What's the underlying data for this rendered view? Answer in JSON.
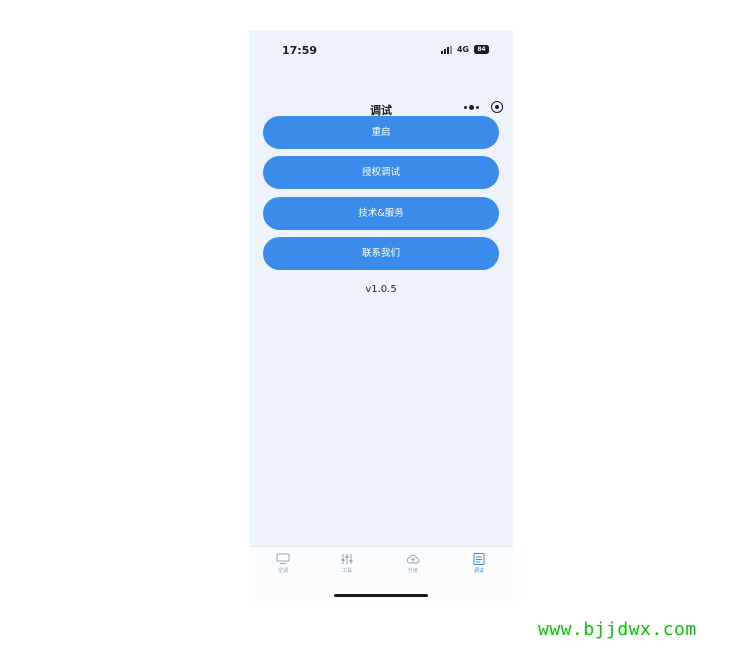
{
  "status_bar": {
    "time": "17:59",
    "network": "4G",
    "battery": "84",
    "signal_icon": "signal-bars-icon"
  },
  "nav": {
    "title": "调试",
    "more_icon": "more-dots-icon",
    "close_icon": "close-circle-icon"
  },
  "buttons": [
    {
      "label": "重启"
    },
    {
      "label": "授权调试"
    },
    {
      "label": "技术&服务"
    },
    {
      "label": "联系我们"
    }
  ],
  "version": "v1.0.5",
  "tabs": [
    {
      "label": "空调",
      "icon": "monitor-icon",
      "active": false
    },
    {
      "label": "工具",
      "icon": "sliders-icon",
      "active": false
    },
    {
      "label": "升级",
      "icon": "cloud-upload-icon",
      "active": false
    },
    {
      "label": "调试",
      "icon": "debug-icon",
      "active": true
    }
  ],
  "colors": {
    "accent": "#3b8bea",
    "screen_background": "#eef3fb",
    "watermark": "#00c800"
  },
  "watermark": "www.bjjdwx.com"
}
